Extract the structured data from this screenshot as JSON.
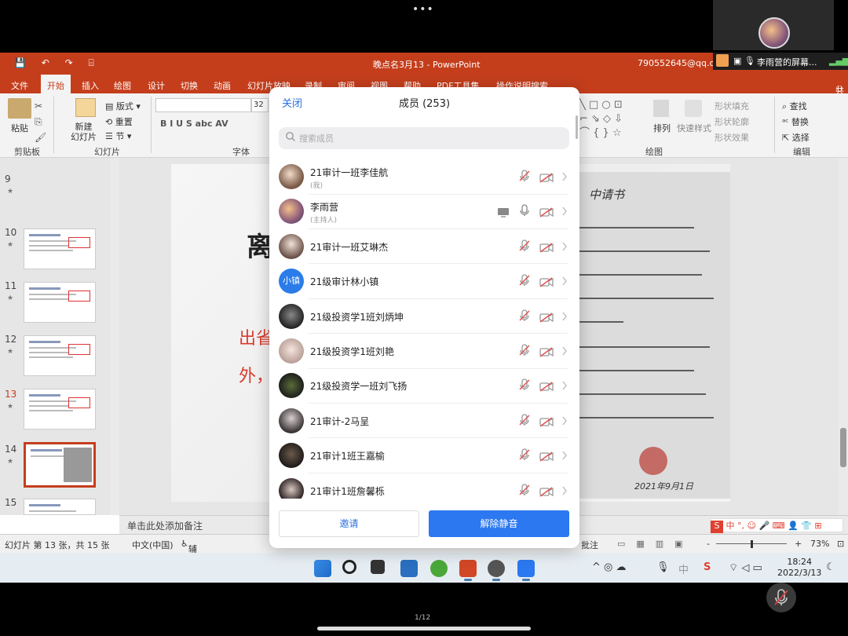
{
  "meeting": {
    "top_menu_dots": "•••",
    "share_banner_text": "李雨营的屏幕...",
    "page_indicator": "1/12"
  },
  "ppt": {
    "title_doc": "晚点名3月13  -  PowerPoint",
    "account": "790552645@qq.con",
    "quick_access": "💾 ↶ ↷ ⌸",
    "tabs": [
      "文件",
      "开始",
      "插入",
      "绘图",
      "设计",
      "切换",
      "动画",
      "幻灯片放映",
      "录制",
      "审阅",
      "视图",
      "帮助",
      "PDF工具集",
      "操作说明搜索"
    ],
    "active_tab": "开始",
    "share_label": "共享",
    "ribbon": {
      "paste": "粘贴",
      "clipboard": "剪贴板",
      "new_slide": "新建\n幻灯片",
      "layout": "版式",
      "reset": "重置",
      "section": "节",
      "slides_group": "幻灯片",
      "font_group": "字体",
      "font_size": "32",
      "font_btns": "B  I  U  S  abc  AV",
      "arrange": "排列",
      "quick_styles": "快速样式",
      "shape_fill": "形状填充",
      "shape_outline": "形状轮廓",
      "shape_effects": "形状效果",
      "drawing_group": "绘图",
      "find": "查找",
      "replace": "替换",
      "select": "选择",
      "editing_group": "编辑"
    },
    "thumbnails": [
      {
        "num": "9"
      },
      {
        "num": "10"
      },
      {
        "num": "11"
      },
      {
        "num": "12"
      },
      {
        "num": "13"
      },
      {
        "num": "14"
      },
      {
        "num": "15"
      }
    ],
    "selected_slide": "13",
    "slide": {
      "title_partial": "离",
      "red_line1": "出省",
      "red_line2": "外，",
      "handwriting_heading": "中请书",
      "signature_date": "2021年9月1日"
    },
    "notes_placeholder": "单击此处添加备注",
    "ime_bar": "中 °, ☺ 🎤 ⌨ 👤 👕 ⊞",
    "status": {
      "slide_info": "幻灯片 第 13 张，共 15 张",
      "language": "中文(中国)",
      "accessibility": "辅助功能: 调查",
      "comments": "批注",
      "zoom": "73%"
    },
    "taskbar": {
      "time": "18:24",
      "date": "2022/3/13",
      "tray": "^ ◎ ☁"
    }
  },
  "members_panel": {
    "close_label": "关闭",
    "title": "成员 (253)",
    "search_placeholder": "搜索成员",
    "invite_label": "邀请",
    "unmute_all_label": "解除静音",
    "members": [
      {
        "name": "21审计一班李佳航",
        "role": "(我)",
        "sharing": false,
        "mic_muted": true,
        "cam_off": true
      },
      {
        "name": "李雨营",
        "role": "(主持人)",
        "sharing": true,
        "mic_muted": false,
        "cam_off": true
      },
      {
        "name": " 21审计一班艾琳杰",
        "role": "",
        "sharing": false,
        "mic_muted": true,
        "cam_off": true
      },
      {
        "name": "21级审计林小镇",
        "role": "",
        "avatar_text": "小镇",
        "sharing": false,
        "mic_muted": true,
        "cam_off": true
      },
      {
        "name": "21级投资学1班刘炳坤",
        "role": "",
        "sharing": false,
        "mic_muted": true,
        "cam_off": true
      },
      {
        "name": "21级投资学1班刘艳",
        "role": "",
        "sharing": false,
        "mic_muted": true,
        "cam_off": true
      },
      {
        "name": "21级投资学一班刘飞扬",
        "role": "",
        "sharing": false,
        "mic_muted": true,
        "cam_off": true
      },
      {
        "name": "21审计-2马呈",
        "role": "",
        "sharing": false,
        "mic_muted": true,
        "cam_off": true
      },
      {
        "name": "21审计1班王嘉榆",
        "role": "",
        "sharing": false,
        "mic_muted": true,
        "cam_off": true
      },
      {
        "name": "21审计1班詹馨栎",
        "role": "",
        "sharing": false,
        "mic_muted": true,
        "cam_off": true
      }
    ]
  }
}
